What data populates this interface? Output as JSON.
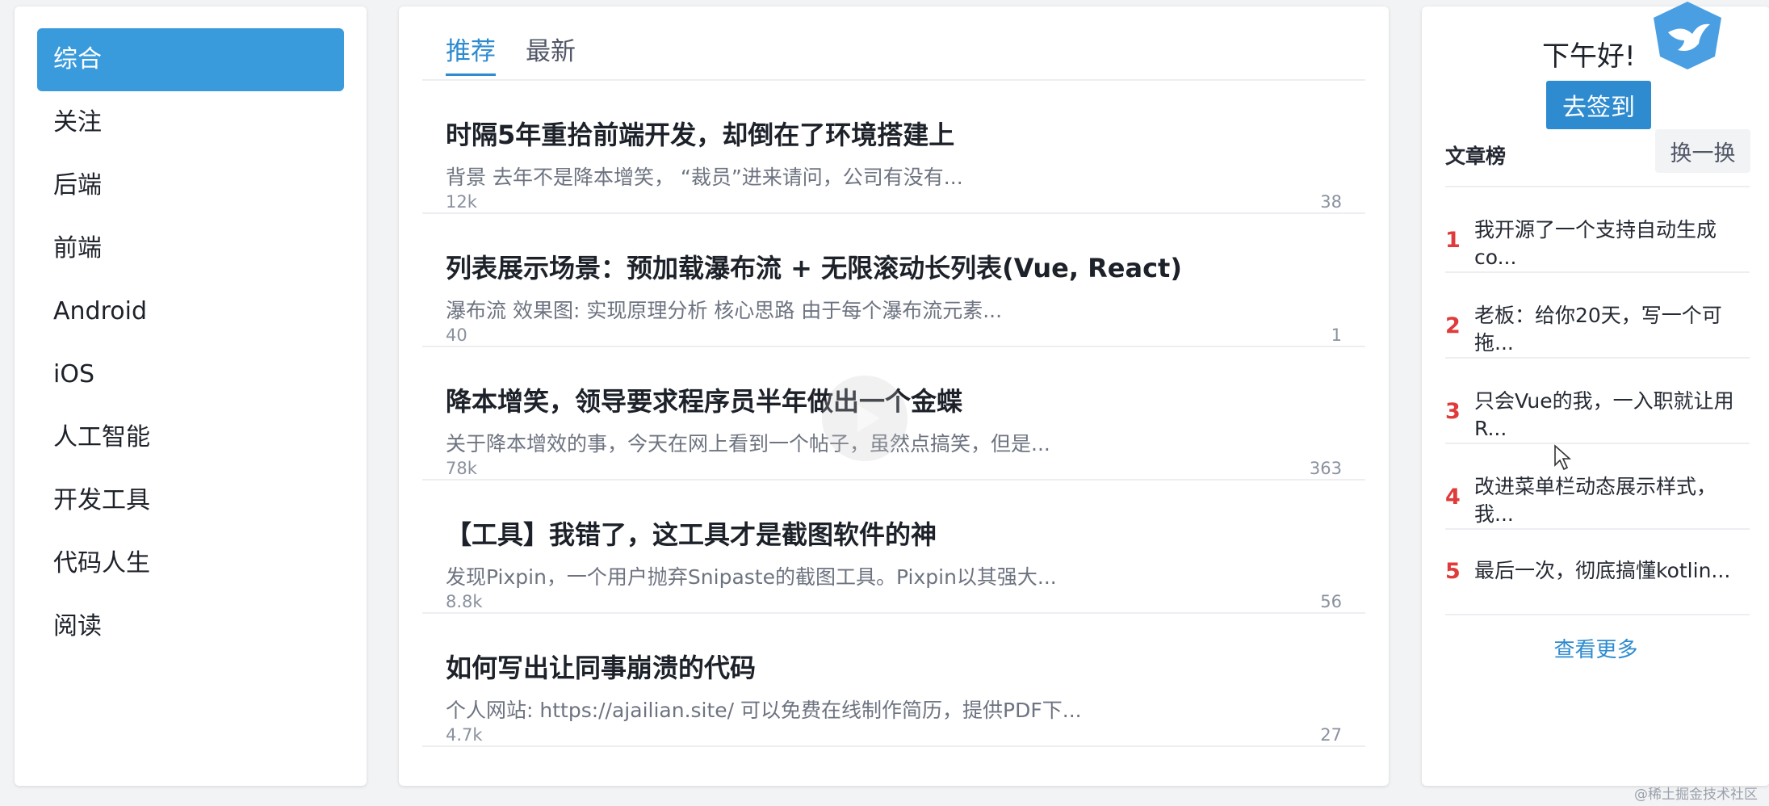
{
  "nav": {
    "items": [
      {
        "label": "综合",
        "active": true
      },
      {
        "label": "关注"
      },
      {
        "label": "后端"
      },
      {
        "label": "前端"
      },
      {
        "label": "Android"
      },
      {
        "label": "iOS"
      },
      {
        "label": "人工智能"
      },
      {
        "label": "开发工具"
      },
      {
        "label": "代码人生"
      },
      {
        "label": "阅读"
      }
    ]
  },
  "feed": {
    "tabs": [
      {
        "label": "推荐",
        "active": true
      },
      {
        "label": "最新"
      }
    ],
    "articles": [
      {
        "title": "时隔5年重拾前端开发，却倒在了环境搭建上",
        "desc": "背景 去年不是降本增笑， “裁员”进来请问，公司有没有...",
        "views": "12k",
        "comments": "38"
      },
      {
        "title": "列表展示场景：预加载瀑布流 + 无限滚动长列表(Vue, React)",
        "desc": "瀑布流 效果图: 实现原理分析 核心思路 由于每个瀑布流元素...",
        "views": "40",
        "comments": "1"
      },
      {
        "title": "降本增笑，领导要求程序员半年做出一个金蝶",
        "desc": "关于降本增效的事，今天在网上看到一个帖子，虽然点搞笑，但是...",
        "views": "78k",
        "comments": "363"
      },
      {
        "title": "【工具】我错了，这工具才是截图软件的神",
        "desc": "发现Pixpin，一个用户抛弃Snipaste的截图工具。Pixpin以其强大...",
        "views": "8.8k",
        "comments": "56"
      },
      {
        "title": "如何写出让同事崩溃的代码",
        "desc": "个人网站: https://ajailian.site/ 可以免费在线制作简历，提供PDF下...",
        "views": "4.7k",
        "comments": "27"
      }
    ]
  },
  "side": {
    "greeting": "下午好!",
    "signin_label": "去签到",
    "rank_title": "文章榜",
    "refresh_label": "换一换",
    "ranks": [
      {
        "num": "1",
        "text": "我开源了一个支持自动生成co..."
      },
      {
        "num": "2",
        "text": "老板：给你20天，写一个可拖..."
      },
      {
        "num": "3",
        "text": "只会Vue的我，一入职就让用R..."
      },
      {
        "num": "4",
        "text": "改进菜单栏动态展示样式，我..."
      },
      {
        "num": "5",
        "text": "最后一次，彻底搞懂kotlin..."
      }
    ],
    "more_label": "查看更多"
  },
  "watermark": "@稀土掘金技术社区",
  "colors": {
    "accent": "#2e8bd0",
    "nav_active": "#3a9bdc",
    "rank_num": "#e03a3a"
  }
}
